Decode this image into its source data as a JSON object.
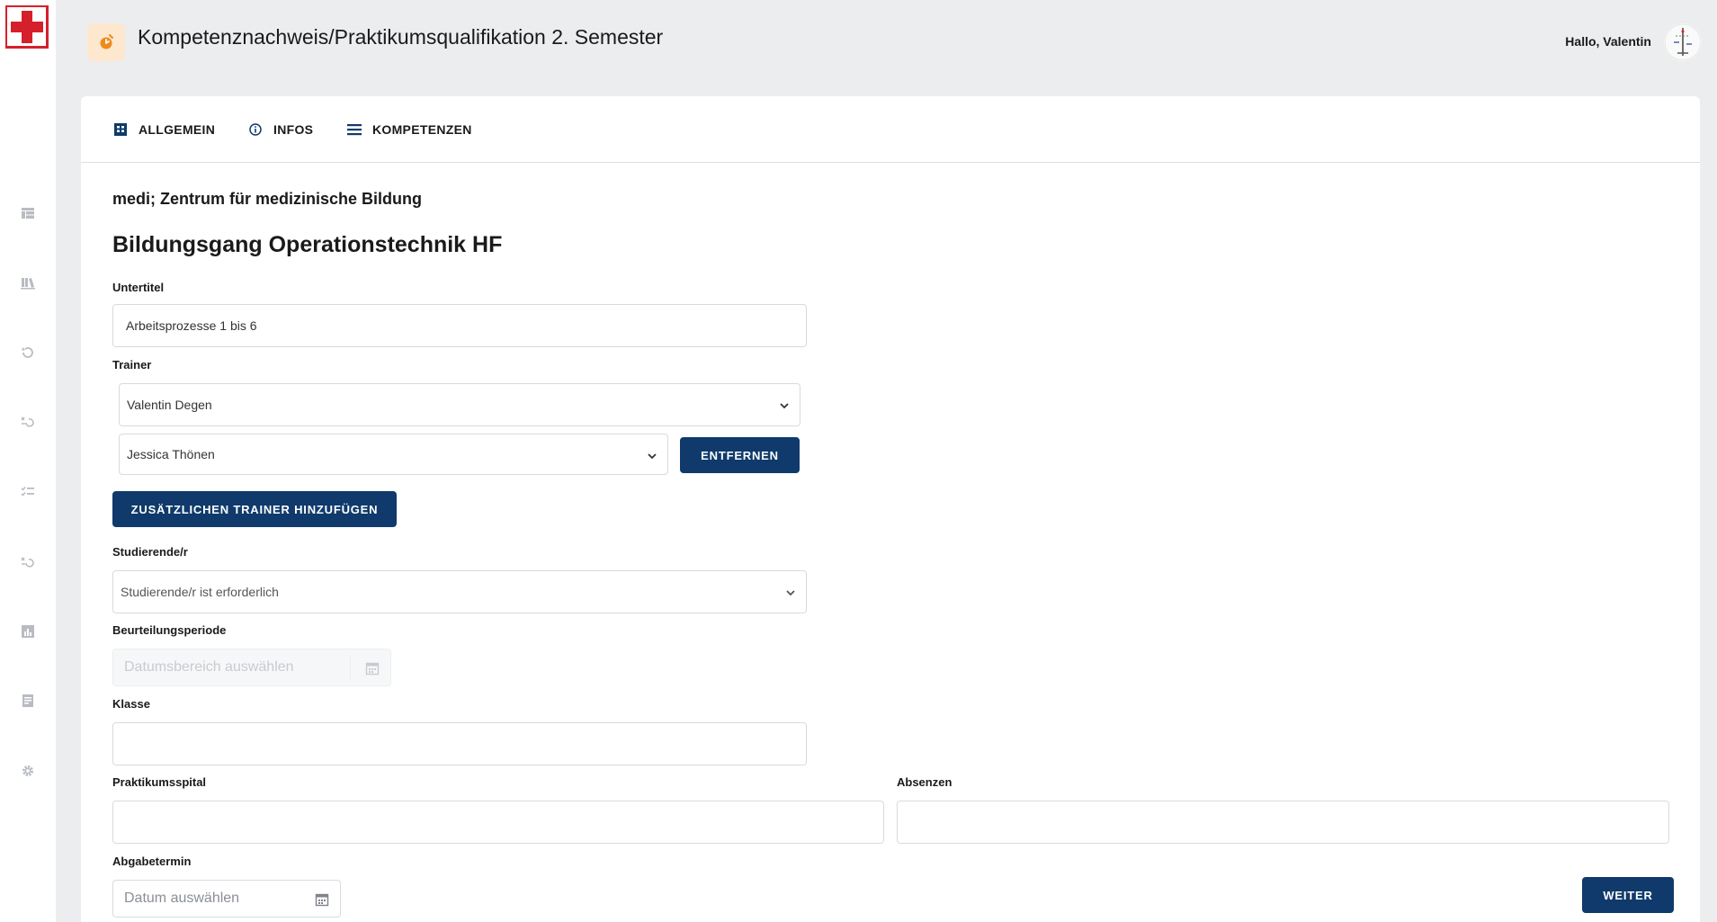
{
  "header": {
    "title": "Kompetenznachweis/Praktikumsqualifikation 2. Semester",
    "greeting": "Hallo, Valentin"
  },
  "colors": {
    "primary": "#0f3a6b",
    "brand_red": "#d5202b",
    "badge_bg": "#fde8cf",
    "badge_icon": "#f08a1c"
  },
  "sidebar": {
    "items": [
      {
        "icon": "table-icon"
      },
      {
        "icon": "library-icon"
      },
      {
        "icon": "history-icon"
      },
      {
        "icon": "undo-list-icon"
      },
      {
        "icon": "checklist-icon"
      },
      {
        "icon": "redo-list-icon"
      },
      {
        "icon": "bar-chart-icon"
      },
      {
        "icon": "document-icon"
      },
      {
        "icon": "gear-icon"
      }
    ]
  },
  "tabs": [
    {
      "label": "ALLGEMEIN",
      "icon": "grid-icon"
    },
    {
      "label": "INFOS",
      "icon": "info-icon"
    },
    {
      "label": "KOMPETENZEN",
      "icon": "list-icon"
    }
  ],
  "form": {
    "organization": "medi; Zentrum für medizinische Bildung",
    "program": "Bildungsgang Operationstechnik HF",
    "subtitle_label": "Untertitel",
    "subtitle_value": "Arbeitsprozesse 1 bis 6",
    "trainer_label": "Trainer",
    "trainer_1": "Valentin Degen",
    "trainer_2": "Jessica Thönen",
    "remove_label": "ENTFERNEN",
    "add_trainer_label": "ZUSÄTZLICHEN TRAINER HINZUFÜGEN",
    "student_label": "Studierende/r",
    "student_placeholder": "Studierende/r ist erforderlich",
    "period_label": "Beurteilungsperiode",
    "period_placeholder": "Datumsbereich auswählen",
    "class_label": "Klasse",
    "class_value": "",
    "hospital_label": "Praktikumsspital",
    "hospital_value": "",
    "absences_label": "Absenzen",
    "absences_value": "",
    "due_label": "Abgabetermin",
    "due_placeholder": "Datum auswählen",
    "next_label": "WEITER"
  }
}
